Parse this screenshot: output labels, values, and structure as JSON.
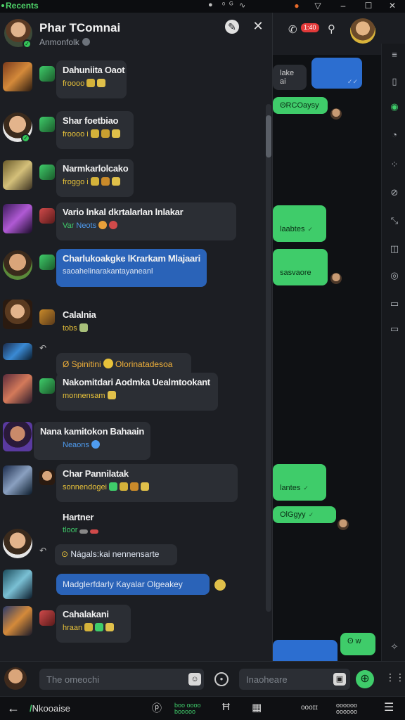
{
  "window": {
    "app_name": "Recents",
    "menu_glyph": "≡",
    "minimize": "–",
    "maximize": "☐",
    "close": "✕",
    "mini_labels": [
      "ᵒ",
      "ᴳ",
      "∿"
    ]
  },
  "header": {
    "name": "Phar TComnai",
    "status": "Anmonfolk"
  },
  "chats": [
    {
      "title": "Dahuniita Oaot",
      "subtitle": "froooo",
      "sub_color": "yellow",
      "emojis": [
        "#d4b23a",
        "#e0c04a"
      ],
      "bubble": "dark"
    },
    {
      "title": "Shar foetbiao",
      "subtitle": "froooo i",
      "sub_color": "yellow",
      "emojis": [
        "#d4b23a",
        "#c9a030",
        "#e0c04a"
      ],
      "bubble": "dark"
    },
    {
      "title": "Narmkarlolcako",
      "subtitle": "froggo i",
      "sub_color": "yellow",
      "emojis": [
        "#d4b23a",
        "#c98a2a",
        "#e0c04a"
      ],
      "bubble": "dark"
    },
    {
      "title": "Vario lnkal dkrtalarlan lnlakar",
      "subtitle": "Var",
      "sub_color": "green",
      "subtitle2": "Neots",
      "emojis": [
        "#3fcc6a",
        "#e8a03a",
        "#d04a4a"
      ],
      "bubble": "dark"
    },
    {
      "title": "Charlukoakgke lKrarkam Mlajaari",
      "subtitle": "saoahelinarakantayaneanl",
      "sub_color": "white",
      "emojis": [],
      "bubble": "blue"
    },
    {
      "title": "Calalnia",
      "subtitle": "tobs",
      "sub_color": "yellow",
      "emojis": [
        "#a8c07a"
      ],
      "bubble": "dark"
    },
    {
      "title": "",
      "subtitle": "Ø Spinitini",
      "subtitle2": "Olorinatadesoa",
      "sub_color": "amber",
      "emojis": [
        "#e8c23a"
      ],
      "bubble": "dark"
    },
    {
      "title": "Nakomitdari Aodmka Uealmtookant",
      "subtitle": "monnensam",
      "sub_color": "yellow",
      "emojis": [
        "#e0c04a"
      ],
      "bubble": "dark"
    },
    {
      "title": "Nana kamitokon Bahaain",
      "subtitle": "Neaons",
      "sub_color": "blue",
      "emojis": [
        "#4f9cf0"
      ],
      "bubble": "dark"
    },
    {
      "title": "Char Pannilatak",
      "subtitle": "sonnendogei",
      "sub_color": "yellow",
      "emojis": [
        "#3fcc6a",
        "#d4b23a",
        "#c98a2a",
        "#e0c04a"
      ],
      "bubble": "dark"
    },
    {
      "title": "Hartner",
      "subtitle": "tloor",
      "sub_color": "green",
      "emojis": [
        "#888",
        "#d04a4a"
      ],
      "bubble": "none"
    },
    {
      "title": "",
      "subtitle": "Nágals:kai nennensarte",
      "sub_color": "white",
      "emojis": [],
      "bubble": "dark"
    },
    {
      "title": "",
      "subtitle": "Madglerfdarly Kayalar Olgeakey",
      "sub_color": "white",
      "emojis": [],
      "bubble": "blue"
    },
    {
      "title": "Cahalakani",
      "subtitle": "hraan",
      "sub_color": "yellow",
      "emojis": [
        "#d4b23a",
        "#3fcc6a",
        "#e0c04a"
      ],
      "bubble": "dark"
    }
  ],
  "background_messages": [
    {
      "text": "lake ai",
      "style": "dark"
    },
    {
      "text": "",
      "style": "blue"
    },
    {
      "text": "ΘRCOaysy",
      "style": "green"
    },
    {
      "text": "laabtes",
      "style": "green"
    },
    {
      "text": "sasvaore",
      "style": "green"
    },
    {
      "text": "lantes",
      "style": "green"
    },
    {
      "text": "OlGgyy",
      "style": "green"
    },
    {
      "text": "",
      "style": "blue"
    },
    {
      "text": "ʘ w",
      "style": "green"
    }
  ],
  "composer": {
    "placeholder_a": "The omeochi",
    "placeholder_b": "Inaoheare",
    "send_glyph": "⊕",
    "grid_glyph": "⋮⋮"
  },
  "bottombar": {
    "back_glyph": "←",
    "label_prefix": "/",
    "label": "Nkooaise",
    "items": [
      "ⓟ",
      "Ħ",
      "▦",
      "oooɪɪ"
    ],
    "green_top": "boo oooo",
    "green_bottom": "booooo",
    "stack_top": "oooooo",
    "stack_bottom": "oooooo",
    "menu_glyph": "☰"
  },
  "colors": {
    "accent_green": "#3fcc6a",
    "accent_blue": "#2a63b8",
    "panel_bg": "#1c1e23",
    "card_bg": "#2b2e34"
  }
}
